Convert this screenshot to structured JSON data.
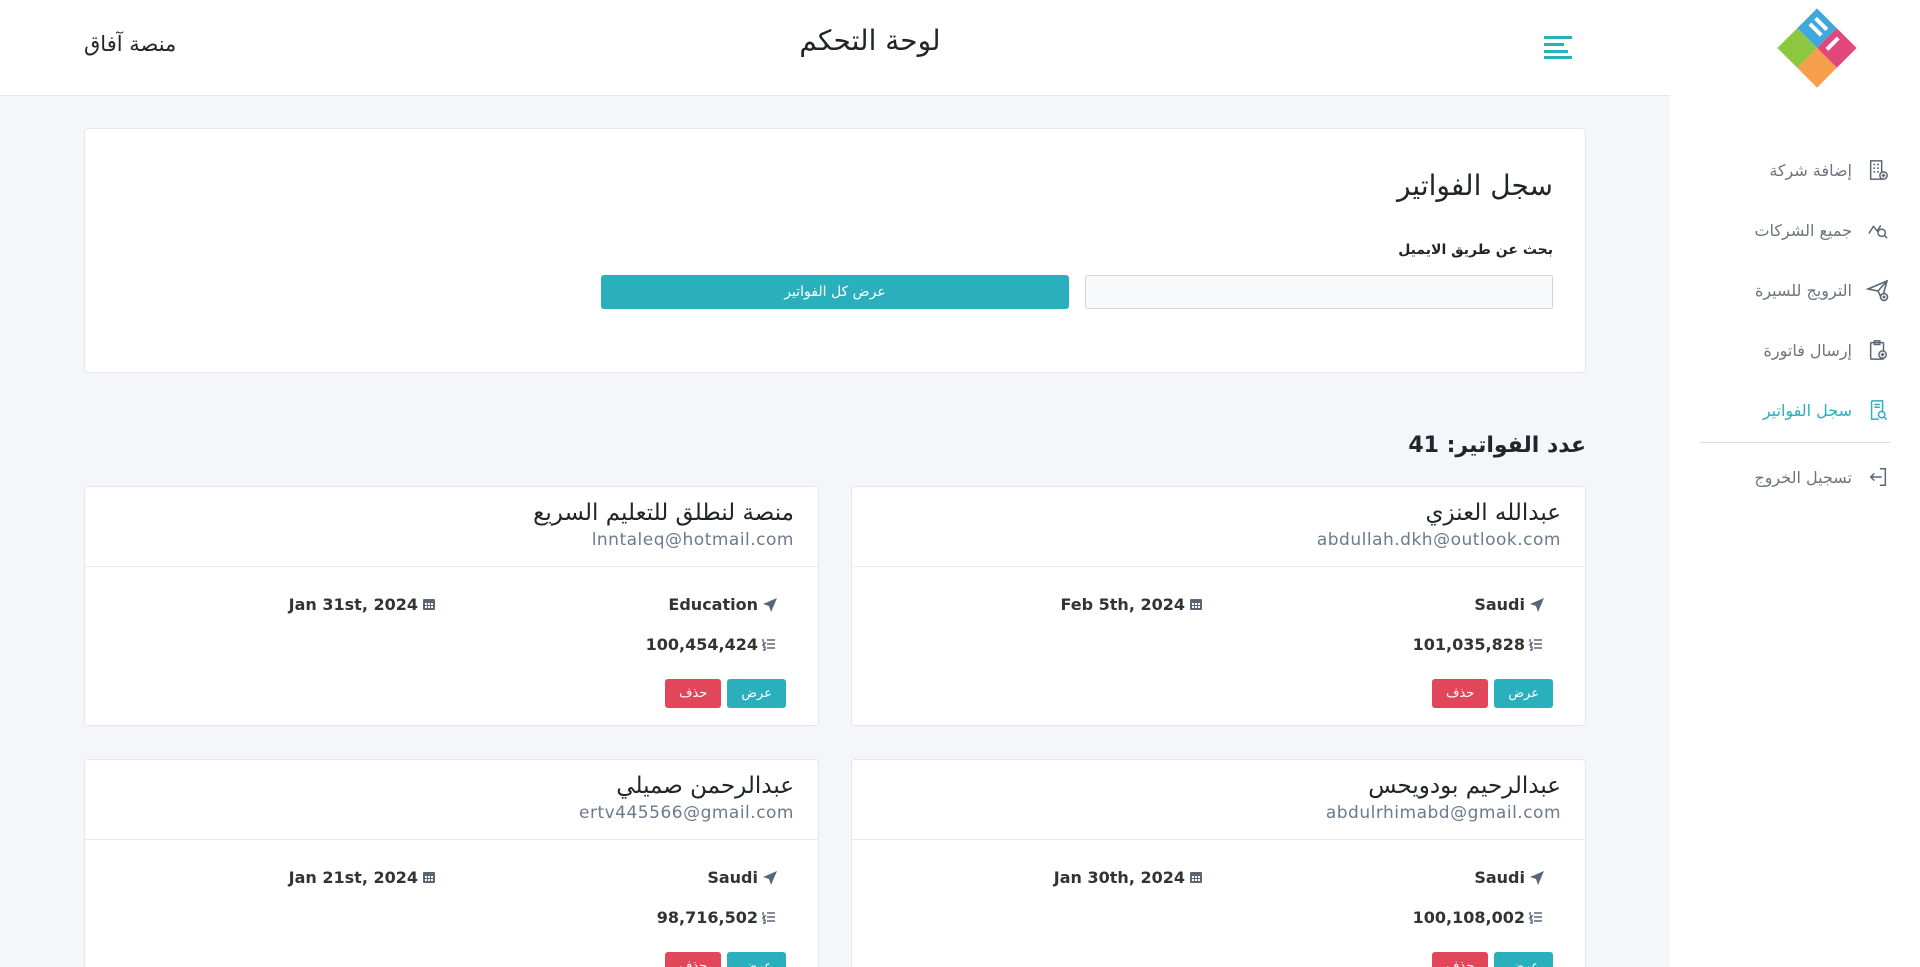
{
  "sidebar": {
    "items": [
      {
        "label": "إضافة شركة",
        "icon": "building-add-icon"
      },
      {
        "label": "جميع الشركات",
        "icon": "companies-search-icon"
      },
      {
        "label": "الترويج للسيرة",
        "icon": "send-plane-icon"
      },
      {
        "label": "إرسال فاتورة",
        "icon": "clipboard-add-icon"
      },
      {
        "label": "سجل الفواتير",
        "icon": "receipt-search-icon",
        "active": true
      },
      {
        "label": "تسجيل الخروج",
        "icon": "logout-icon"
      }
    ]
  },
  "header": {
    "title": "لوحة التحكم",
    "brand": "منصة آفاق"
  },
  "search": {
    "title": "سجل الفواتير",
    "label": "بحث عن طريق الايميل",
    "placeholder": "",
    "show_all_label": "عرض كل الفواتير"
  },
  "count_label": "عدد الفواتير: 41",
  "invoices": [
    {
      "name": "عبدالله العنزي",
      "email": "abdullah.dkh@outlook.com",
      "country": "Saudi",
      "date": "Feb 5th, 2024",
      "amount": "101,035,828",
      "view": "عرض",
      "delete": "حذف"
    },
    {
      "name": "منصة لنطلق للتعليم السريع",
      "email": "lnntaleq@hotmail.com",
      "country": "Education",
      "date": "Jan 31st, 2024",
      "amount": "100,454,424",
      "view": "عرض",
      "delete": "حذف"
    },
    {
      "name": "عبدالرحيم بودويحس",
      "email": "abdulrhimabd@gmail.com",
      "country": "Saudi",
      "date": "Jan 30th, 2024",
      "amount": "100,108,002",
      "view": "عرض",
      "delete": "حذف"
    },
    {
      "name": "عبدالرحمن صميلي",
      "email": "ertv445566@gmail.com",
      "country": "Saudi",
      "date": "Jan 21st, 2024",
      "amount": "98,716,502",
      "view": "عرض",
      "delete": "حذف"
    }
  ],
  "colors": {
    "accent": "#2ab0bd",
    "danger": "#e2465b"
  }
}
